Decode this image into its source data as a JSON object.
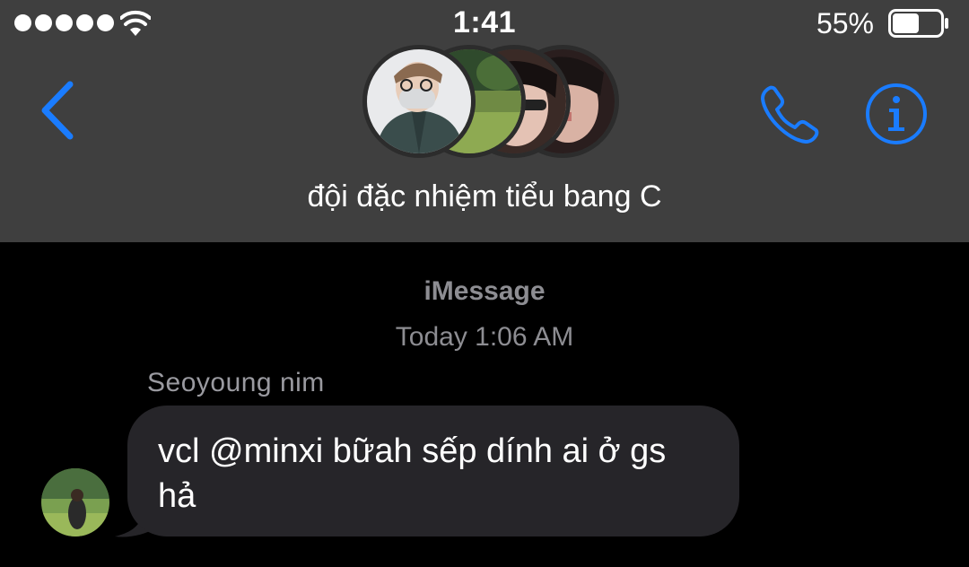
{
  "status_bar": {
    "signal_dots": 5,
    "time": "1:41",
    "battery_percent": "55%",
    "battery_level": 0.55
  },
  "header": {
    "back_icon": "chevron-left-icon",
    "phone_icon": "phone-icon",
    "info_icon": "info-icon",
    "title": "đội đặc nhiệm tiểu bang C",
    "accent_color": "#1a7cff",
    "background_color": "#3f3f3f"
  },
  "thread": {
    "service": "iMessage",
    "timestamp": "Today 1:06 AM",
    "messages": [
      {
        "sender": "Seoyoung nim",
        "text": "vcl @minxi bữah sếp dính ai ở gs hả",
        "direction": "incoming",
        "bubble_color": "#262529"
      }
    ]
  }
}
